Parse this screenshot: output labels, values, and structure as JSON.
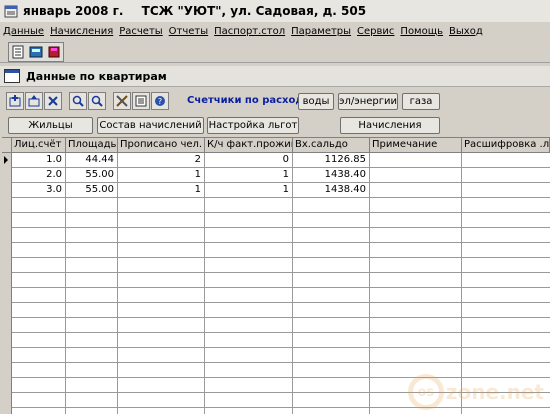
{
  "window": {
    "title_period": "январь 2008 г.",
    "title_org": "ТСЖ \"УЮТ\", ул. Садовая, д. 505"
  },
  "menu": {
    "items": [
      "Данные",
      "Начисления",
      "Расчеты",
      "Отчеты",
      "Паспорт.стол",
      "Параметры",
      "Сервис",
      "Помощь",
      "Выход"
    ]
  },
  "toolbar": {
    "icons": [
      "notepad-icon",
      "calculator-icon",
      "book-icon"
    ]
  },
  "section": {
    "title": "Данные по квартирам"
  },
  "counters": {
    "label": "Счетчики по расходу",
    "water": "воды",
    "electricity": "эл/энергии",
    "gas": "газа"
  },
  "actions": {
    "residents": "Жильцы",
    "charges_composition": "Состав начислений",
    "benefits_setup": "Настройка льгот",
    "charges": "Начисления"
  },
  "table": {
    "columns": [
      "Лиц.счёт",
      "Площадь",
      "Прописано чел.",
      "К/ч факт.прожив",
      "Вх.сальдо",
      "Примечание",
      "Расшифровка .ль"
    ],
    "rows": [
      {
        "account": "1.0",
        "area": "44.44",
        "registered": "2",
        "actual": "0",
        "balance": "1126.85",
        "note": "",
        "details": ""
      },
      {
        "account": "2.0",
        "area": "55.00",
        "registered": "1",
        "actual": "1",
        "balance": "1438.40",
        "note": "",
        "details": ""
      },
      {
        "account": "3.0",
        "area": "55.00",
        "registered": "1",
        "actual": "1",
        "balance": "1438.40",
        "note": "",
        "details": ""
      }
    ]
  },
  "watermark": {
    "text": "zone.net",
    "circle_text": "os"
  }
}
